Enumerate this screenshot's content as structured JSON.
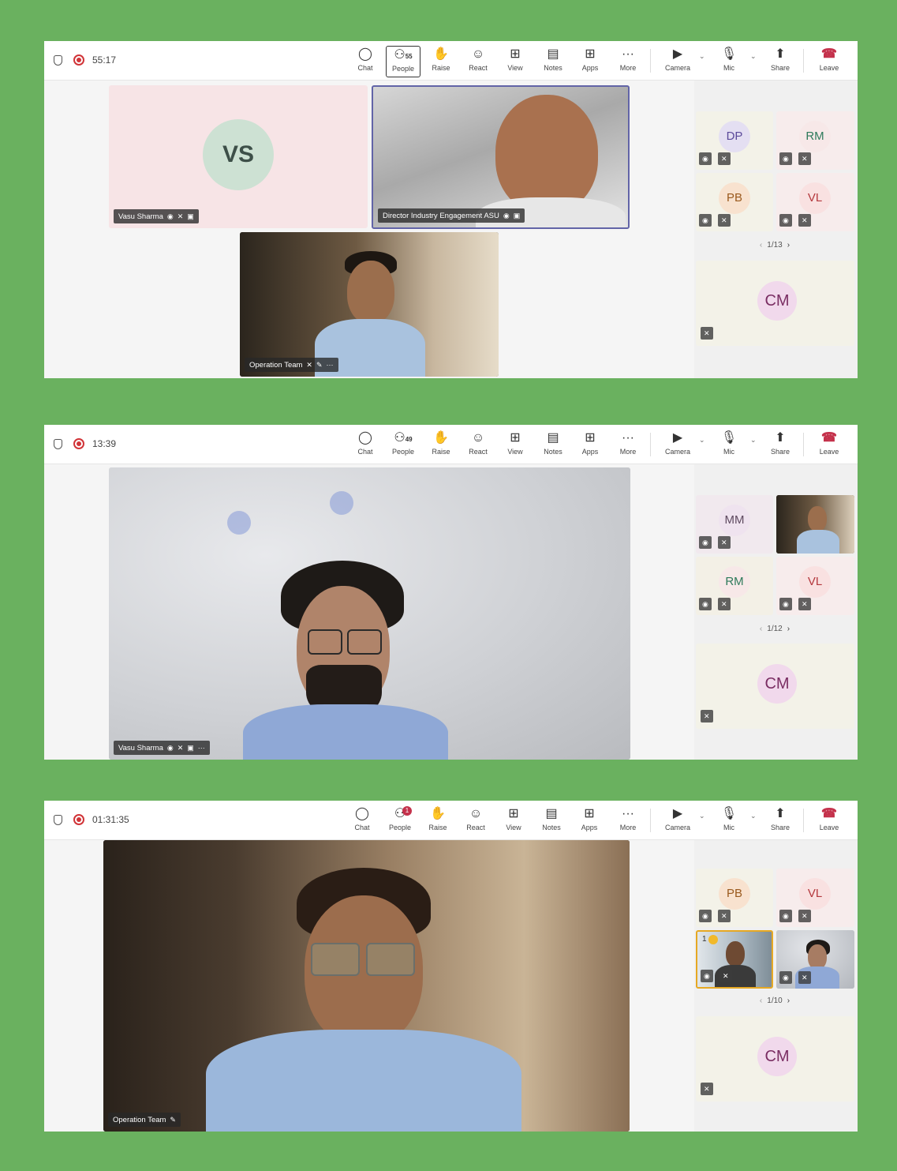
{
  "toolbar": {
    "chat": "Chat",
    "people": "People",
    "raise": "Raise",
    "react": "React",
    "view": "View",
    "notes": "Notes",
    "apps": "Apps",
    "more": "More",
    "camera": "Camera",
    "mic": "Mic",
    "share": "Share",
    "leave": "Leave"
  },
  "icons": {
    "chat": "chat-bubble-icon",
    "people": "people-icon",
    "raise": "hand-icon",
    "react": "smiley-icon",
    "view": "grid-icon",
    "notes": "notes-icon",
    "apps": "plus-box-icon",
    "more": "ellipsis-icon",
    "camera": "camera-off-icon",
    "mic": "mic-off-icon",
    "share": "share-icon",
    "leave": "phone-hangup-icon"
  },
  "colors": {
    "background": "#6ab15f",
    "recording": "#d13438",
    "active_speaker_border": "#6264a7",
    "spotlight_border": "#e6a823"
  },
  "shot1": {
    "timer": "55:17",
    "people_count": "55",
    "vs_initials": "VS",
    "vs_name": "Vasu Sharma",
    "director_name": "Director Industry Engagement ASU",
    "ops_name": "Operation Team",
    "side": [
      "DP",
      "RM",
      "PB",
      "VL"
    ],
    "pager": "1/13",
    "cm": "CM"
  },
  "shot2": {
    "timer": "13:39",
    "people_count": "49",
    "main_name": "Vasu Sharma",
    "side": [
      "MM",
      "RM",
      "VL"
    ],
    "pager": "1/12",
    "cm": "CM"
  },
  "shot3": {
    "timer": "01:31:35",
    "people_badge": "1",
    "main_name": "Operation Team",
    "side": [
      "PB",
      "VL"
    ],
    "reaction_count": "1",
    "pager": "1/10",
    "cm": "CM"
  }
}
